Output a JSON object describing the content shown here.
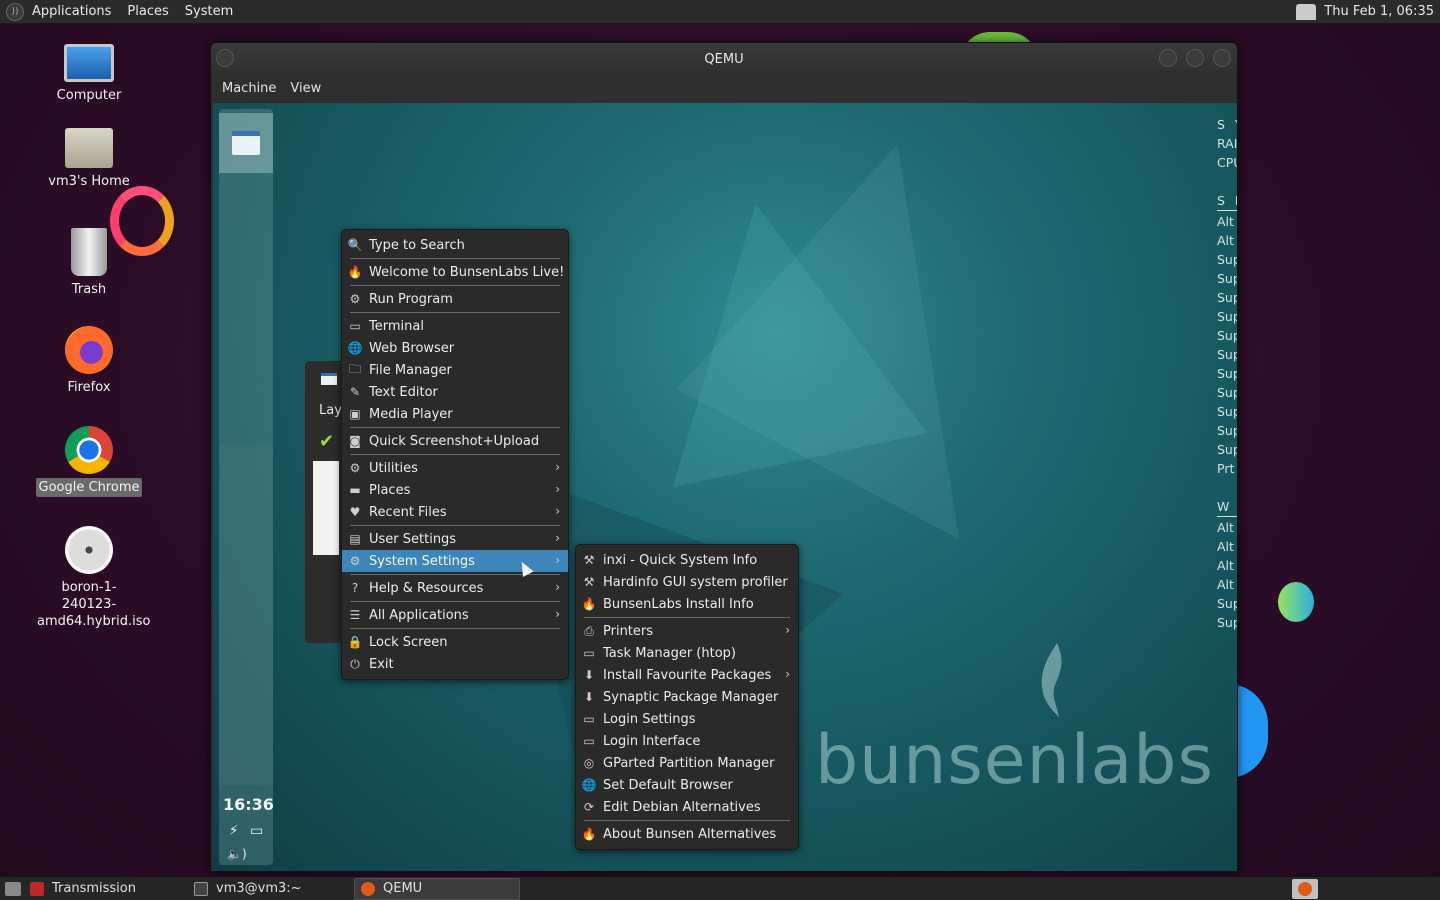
{
  "top_panel": {
    "menus": [
      "Applications",
      "Places",
      "System"
    ],
    "clock": "Thu Feb  1, 06:35"
  },
  "desktop_icons": [
    {
      "label": "Computer"
    },
    {
      "label": "vm3's Home"
    },
    {
      "label": "Trash"
    },
    {
      "label": "Firefox"
    },
    {
      "label": "Google Chrome"
    },
    {
      "label": "boron-1-240123-amd64.hybrid.iso"
    }
  ],
  "qemu": {
    "title": "QEMU",
    "menubar": [
      "Machine",
      "View"
    ]
  },
  "guest": {
    "dock": {
      "clock": "16:36",
      "tray": [
        "⚡",
        "▭"
      ],
      "volume": "🔈)"
    },
    "bg_window": {
      "label": "Lay"
    },
    "conky": [
      "S Y",
      "RAI",
      "CPU",
      "",
      "S H",
      "---",
      "Alt",
      "Alt",
      "Sup",
      "Sup",
      "Sup",
      "Sup",
      "Sup",
      "Sup",
      "Sup",
      "Sup",
      "Sup",
      "Sup",
      "Sup",
      "Prt",
      "",
      "W I",
      "---",
      "Alt",
      "Alt",
      "Alt",
      "Alt",
      "Sup",
      "Sup"
    ],
    "logo_text": "bunsenlabs",
    "main_menu": [
      {
        "label": "Type to Search",
        "icon": "search-icon",
        "glyph": "🔍"
      },
      {
        "sep": true
      },
      {
        "label": "Welcome to BunsenLabs Live!",
        "icon": "flame-icon",
        "glyph": "🔥"
      },
      {
        "sep": true
      },
      {
        "label": "Run Program",
        "icon": "gears-icon",
        "glyph": "⚙"
      },
      {
        "sep": true
      },
      {
        "label": "Terminal",
        "icon": "terminal-icon",
        "glyph": "▭"
      },
      {
        "label": "Web Browser",
        "icon": "globe-icon",
        "glyph": "🌐"
      },
      {
        "label": "File Manager",
        "icon": "folder-icon",
        "glyph": "🗀"
      },
      {
        "label": "Text Editor",
        "icon": "edit-icon",
        "glyph": "✎"
      },
      {
        "label": "Media Player",
        "icon": "media-icon",
        "glyph": "▣"
      },
      {
        "sep": true
      },
      {
        "label": "Quick Screenshot+Upload",
        "icon": "camera-icon",
        "glyph": "◙"
      },
      {
        "sep": true
      },
      {
        "label": "Utilities",
        "icon": "gears-icon",
        "glyph": "⚙",
        "submenu": true
      },
      {
        "label": "Places",
        "icon": "folder-icon",
        "glyph": "▬",
        "submenu": true
      },
      {
        "label": "Recent Files",
        "icon": "heart-icon",
        "glyph": "♥",
        "submenu": true
      },
      {
        "sep": true
      },
      {
        "label": "User Settings",
        "icon": "settings-icon",
        "glyph": "▤",
        "submenu": true
      },
      {
        "label": "System Settings",
        "icon": "gear-icon",
        "glyph": "⚙",
        "submenu": true,
        "active": true
      },
      {
        "sep": true
      },
      {
        "label": "Help & Resources",
        "icon": "help-icon",
        "glyph": "?",
        "submenu": true
      },
      {
        "sep": true
      },
      {
        "label": "All Applications",
        "icon": "list-icon",
        "glyph": "☰",
        "submenu": true
      },
      {
        "sep": true
      },
      {
        "label": "Lock Screen",
        "icon": "lock-icon",
        "glyph": "🔒"
      },
      {
        "label": "Exit",
        "icon": "power-icon",
        "glyph": "⏻"
      }
    ],
    "sub_menu": [
      {
        "label": "inxi - Quick System Info",
        "icon": "tools-icon",
        "glyph": "⚒"
      },
      {
        "label": "Hardinfo GUI system profiler",
        "icon": "tools-icon",
        "glyph": "⚒"
      },
      {
        "label": "BunsenLabs Install Info",
        "icon": "flame-icon",
        "glyph": "🔥"
      },
      {
        "sep": true
      },
      {
        "label": "Printers",
        "icon": "printer-icon",
        "glyph": "⎙",
        "submenu": true
      },
      {
        "label": "Task Manager (htop)",
        "icon": "terminal-icon",
        "glyph": "▭"
      },
      {
        "label": "Install Favourite Packages",
        "icon": "download-icon",
        "glyph": "⬇",
        "submenu": true
      },
      {
        "label": "Synaptic Package Manager",
        "icon": "download-icon",
        "glyph": "⬇"
      },
      {
        "label": "Login Settings",
        "icon": "window-icon",
        "glyph": "▭"
      },
      {
        "label": "Login Interface",
        "icon": "window-icon",
        "glyph": "▭"
      },
      {
        "label": "GParted Partition Manager",
        "icon": "disk-icon",
        "glyph": "◎"
      },
      {
        "label": "Set Default Browser",
        "icon": "globe-icon",
        "glyph": "🌐"
      },
      {
        "label": "Edit Debian Alternatives",
        "icon": "alternatives-icon",
        "glyph": "⟳"
      },
      {
        "sep": true
      },
      {
        "label": "About Bunsen Alternatives",
        "icon": "flame-icon",
        "glyph": "🔥"
      }
    ]
  },
  "taskbar": {
    "items": [
      {
        "label": "Transmission",
        "color": "#c02828"
      },
      {
        "label": "vm3@vm3:~",
        "color": "#444444"
      },
      {
        "label": "QEMU",
        "color": "#e05a1a"
      }
    ]
  },
  "colors": {
    "menu_highlight": "#3f86b8",
    "guest_bg": "#1f6b72",
    "desktop_bg": "#2b0c26"
  }
}
